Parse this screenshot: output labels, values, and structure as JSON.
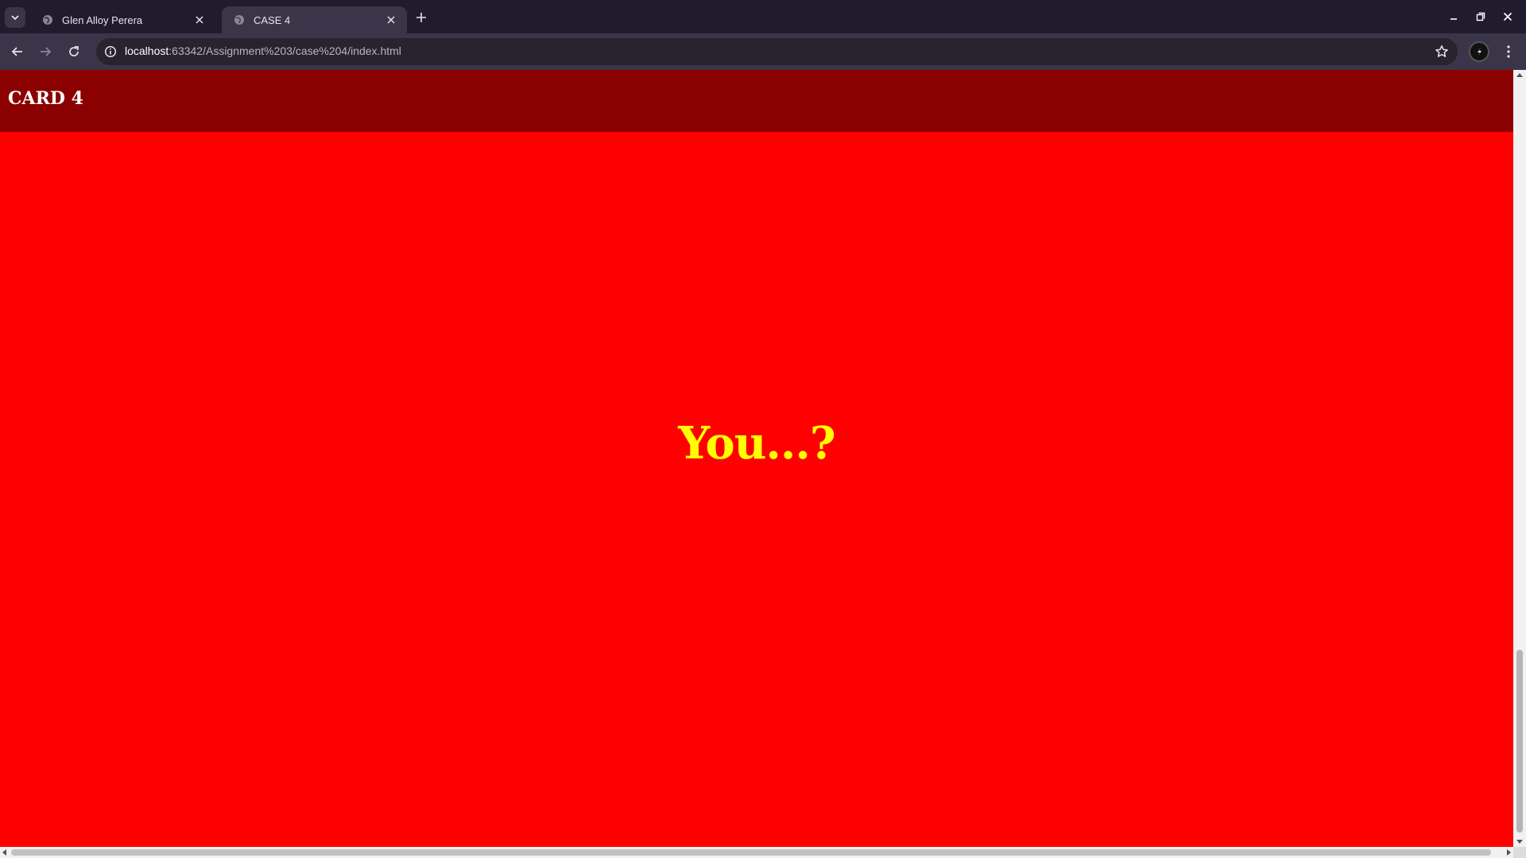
{
  "browser": {
    "tabs": [
      {
        "title": "Glen Alloy Perera",
        "active": false,
        "favicon": "globe-icon"
      },
      {
        "title": "CASE 4",
        "active": true,
        "favicon": "globe-icon"
      }
    ],
    "address": {
      "host": "localhost",
      "rest": ":63342/Assignment%203/case%204/index.html"
    },
    "colors": {
      "tabstrip": "#201c2e",
      "toolbar": "#3a3548"
    }
  },
  "page": {
    "header_title": "CARD 4",
    "message": "You...?",
    "colors": {
      "header_bg": "#8b0000",
      "body_bg": "#ff0000",
      "message_text": "#ffff00",
      "header_text": "#ffffff"
    }
  }
}
